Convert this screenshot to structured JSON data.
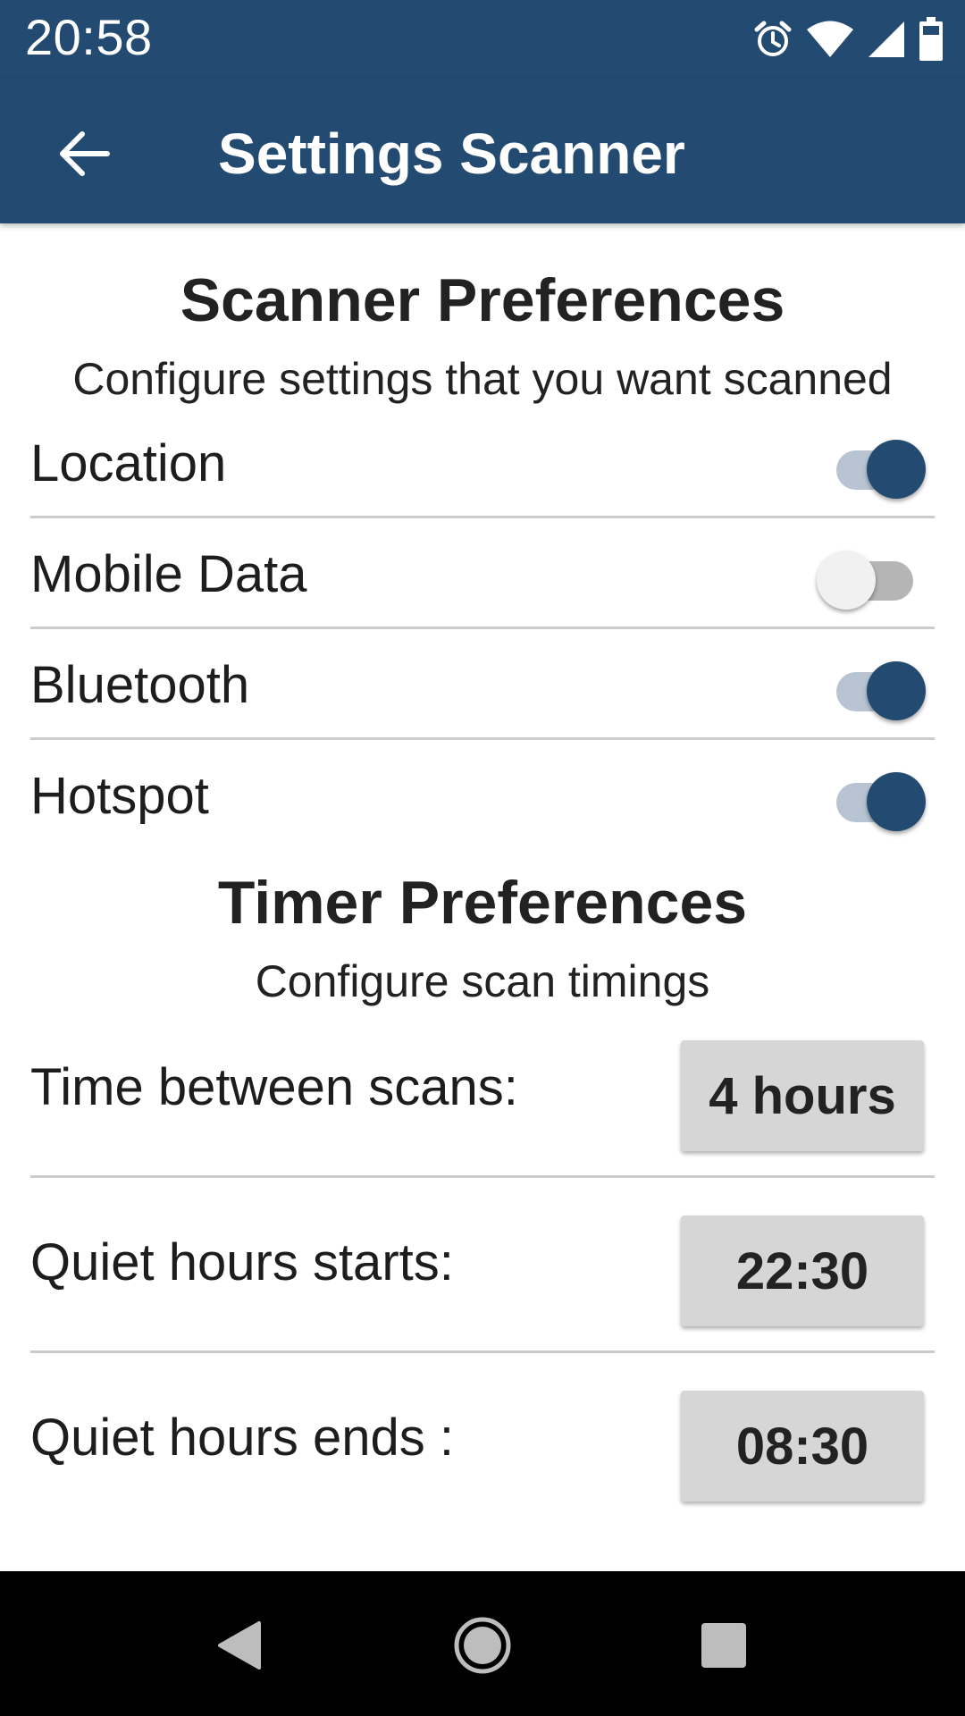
{
  "status_bar": {
    "time": "20:58",
    "icons": [
      "alarm-icon",
      "wifi-icon",
      "signal-icon",
      "battery-icon"
    ]
  },
  "app_bar": {
    "title": "Settings Scanner",
    "back_icon": "arrow-back-icon"
  },
  "scanner": {
    "title": "Scanner Preferences",
    "subtitle": "Configure settings that you want scanned",
    "toggles": [
      {
        "label": "Location",
        "on": true
      },
      {
        "label": "Mobile Data",
        "on": false
      },
      {
        "label": "Bluetooth",
        "on": true
      },
      {
        "label": "Hotspot",
        "on": true
      }
    ]
  },
  "timer": {
    "title": "Timer Preferences",
    "subtitle": "Configure scan timings",
    "rows": [
      {
        "label": "Time between scans:",
        "value": "4 hours"
      },
      {
        "label": "Quiet hours starts:",
        "value": "22:30"
      },
      {
        "label": "Quiet hours ends :",
        "value": "08:30"
      }
    ]
  },
  "colors": {
    "primary": "#234a70",
    "switch_track_on": "#b8c4d2",
    "switch_track_off": "#b5b5b5",
    "button_bg": "#d6d6d6",
    "divider": "#cccccc",
    "nav_bar": "#000000"
  },
  "nav_bar": {
    "icons": [
      "nav-back-icon",
      "nav-home-icon",
      "nav-recents-icon"
    ]
  }
}
